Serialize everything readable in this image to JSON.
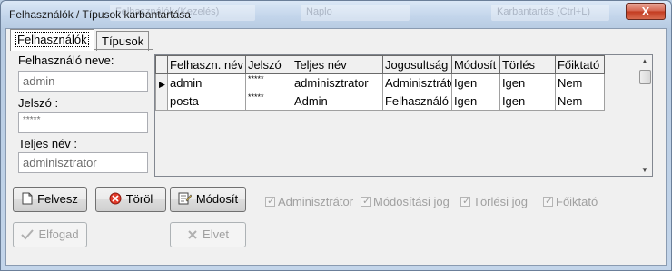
{
  "window": {
    "title": "Felhasználók / Típusok karbantartása",
    "close_label": "X",
    "ghost_titles": [
      "Felhasználók (Kezelés)",
      "Naplo",
      "Karbantartás (Ctrl+L)"
    ]
  },
  "tabs": [
    {
      "label": "Felhasználók",
      "active": true
    },
    {
      "label": "Típusok",
      "active": false
    }
  ],
  "form": {
    "username_label": "Felhasználó neve:",
    "username_value": "admin",
    "password_label": "Jelszó :",
    "password_value": "*****",
    "fullname_label": "Teljes név :",
    "fullname_value": "adminisztrator"
  },
  "grid": {
    "columns": [
      "Felhaszn. név",
      "Jelszó",
      "Teljes név",
      "Jogosultság",
      "Módosít",
      "Törlés",
      "Főiktató"
    ],
    "rows": [
      {
        "selected": true,
        "cells": [
          "admin",
          "*****",
          "adminisztrator",
          "Adminisztrátor",
          "Igen",
          "Igen",
          "Nem"
        ]
      },
      {
        "selected": false,
        "cells": [
          "posta",
          "*****",
          "Admin",
          "Felhasználó",
          "Igen",
          "Igen",
          "Nem"
        ]
      }
    ]
  },
  "buttons": {
    "add": "Felvesz",
    "delete": "Töröl",
    "modify": "Módosít",
    "accept": "Elfogad",
    "reject": "Elvet"
  },
  "checkboxes": [
    {
      "label": "Adminisztrátor",
      "checked": true
    },
    {
      "label": "Módosítási jog",
      "checked": true
    },
    {
      "label": "Törlési jog",
      "checked": true
    },
    {
      "label": "Főiktató",
      "checked": true
    }
  ]
}
